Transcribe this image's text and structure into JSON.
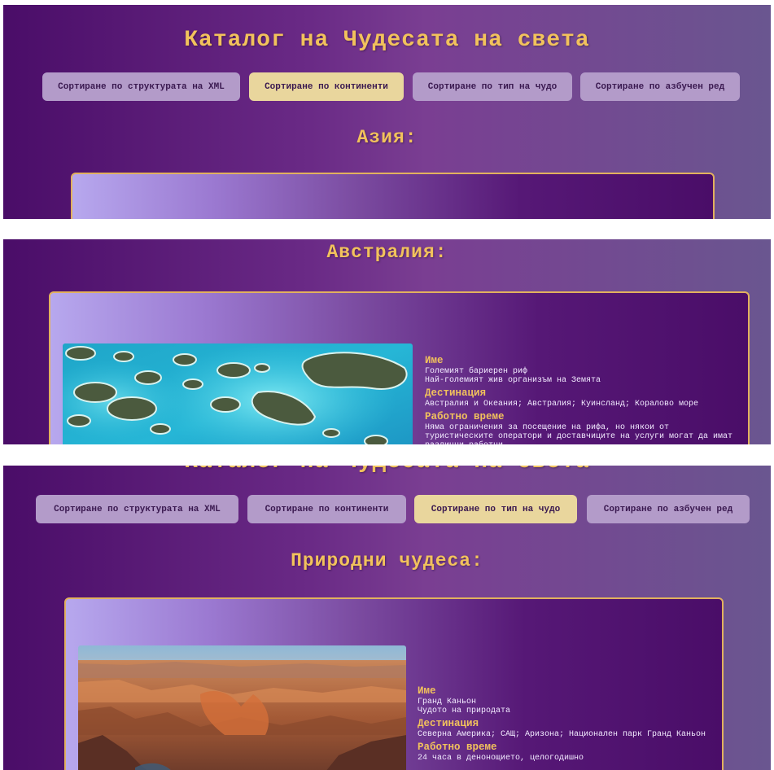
{
  "page_title": "Каталог на Чудесата на света",
  "sort_buttons": {
    "xml": "Сортиране по структурата на XML",
    "continents": "Сортиране по континенти",
    "type": "Сортиране по тип на чудо",
    "alpha": "Сортиране по азбучен ред"
  },
  "screen1": {
    "active_sort": "continents",
    "section_title": "Азия:"
  },
  "screen2": {
    "section_title": "Австралия:",
    "card": {
      "photo_icon": "coral-reef-photo",
      "name_label": "Име",
      "name": "Големият бариерен риф",
      "subtitle": "Най-големият жив организъм на Земята",
      "destination_label": "Дестинация",
      "destination": "Австралия и Океания; Австралия; Куинсланд; Коралово море",
      "hours_label": "Работно време",
      "hours": "Няма ограничения за посещение на рифа, но някои от туристическите оператори и доставчиците на услуги могат да имат различни работни"
    }
  },
  "screen3": {
    "active_sort": "type",
    "section_title": "Природни чудеса:",
    "card": {
      "photo_icon": "canyon-photo",
      "name_label": "Име",
      "name": "Гранд Каньон",
      "subtitle": "Чудото на природата",
      "destination_label": "Дестинация",
      "destination": "Северна Америка; САЩ; Аризона; Национален парк Гранд Каньон",
      "hours_label": "Работно време",
      "hours": "24 часа в денонощието, целогодишно"
    }
  },
  "colors": {
    "accent_gold": "#f2c25c",
    "button": "#b39bc9",
    "button_active": "#e9d69d",
    "background_purple": "#4a0d68"
  }
}
